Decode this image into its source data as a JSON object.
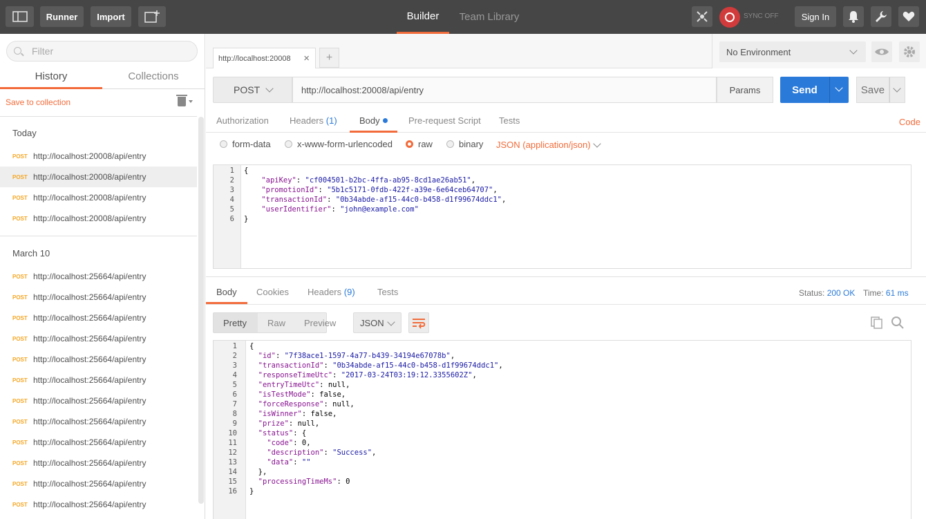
{
  "topbar": {
    "runner_label": "Runner",
    "import_label": "Import",
    "builder_label": "Builder",
    "team_library_label": "Team Library",
    "sync_label": "SYNC OFF",
    "sign_in_label": "Sign In"
  },
  "sidebar": {
    "filter_placeholder": "Filter",
    "tab_history": "History",
    "tab_collections": "Collections",
    "save_to_collection": "Save to collection",
    "groups": [
      {
        "title": "Today",
        "items": [
          {
            "method": "POST",
            "url": "http://localhost:20008/api/entry"
          },
          {
            "method": "POST",
            "url": "http://localhost:20008/api/entry"
          },
          {
            "method": "POST",
            "url": "http://localhost:20008/api/entry"
          },
          {
            "method": "POST",
            "url": "http://localhost:20008/api/entry"
          }
        ]
      },
      {
        "title": "March 10",
        "items": [
          {
            "method": "POST",
            "url": "http://localhost:25664/api/entry"
          },
          {
            "method": "POST",
            "url": "http://localhost:25664/api/entry"
          },
          {
            "method": "POST",
            "url": "http://localhost:25664/api/entry"
          },
          {
            "method": "POST",
            "url": "http://localhost:25664/api/entry"
          },
          {
            "method": "POST",
            "url": "http://localhost:25664/api/entry"
          },
          {
            "method": "POST",
            "url": "http://localhost:25664/api/entry"
          },
          {
            "method": "POST",
            "url": "http://localhost:25664/api/entry"
          },
          {
            "method": "POST",
            "url": "http://localhost:25664/api/entry"
          },
          {
            "method": "POST",
            "url": "http://localhost:25664/api/entry"
          },
          {
            "method": "POST",
            "url": "http://localhost:25664/api/entry"
          },
          {
            "method": "POST",
            "url": "http://localhost:25664/api/entry"
          },
          {
            "method": "POST",
            "url": "http://localhost:25664/api/entry"
          }
        ]
      }
    ]
  },
  "request": {
    "tab_label": "http://localhost:20008",
    "environment": "No Environment",
    "method": "POST",
    "url": "http://localhost:20008/api/entry",
    "params_label": "Params",
    "send_label": "Send",
    "save_label": "Save",
    "tabs": {
      "authorization": "Authorization",
      "headers": "Headers",
      "headers_count": "(1)",
      "body": "Body",
      "prerequest": "Pre-request Script",
      "tests": "Tests",
      "code": "Code"
    },
    "body_options": {
      "form_data": "form-data",
      "urlencoded": "x-www-form-urlencoded",
      "raw": "raw",
      "binary": "binary",
      "content_type": "JSON (application/json)"
    },
    "body_lines": [
      "{",
      "    \"apiKey\": \"cf004501-b2bc-4ffa-ab95-8cd1ae26ab51\",",
      "    \"promotionId\": \"5b1c5171-0fdb-422f-a39e-6e64ceb64707\",",
      "    \"transactionId\": \"0b34abde-af15-44c0-b458-d1f99674ddc1\",",
      "    \"userIdentifier\": \"john@example.com\"",
      "}"
    ]
  },
  "response": {
    "tabs": {
      "body": "Body",
      "cookies": "Cookies",
      "headers": "Headers",
      "headers_count": "(9)",
      "tests": "Tests"
    },
    "status_label": "Status:",
    "status_value": "200 OK",
    "time_label": "Time:",
    "time_value": "61 ms",
    "views": {
      "pretty": "Pretty",
      "raw": "Raw",
      "preview": "Preview"
    },
    "format": "JSON",
    "body_lines": [
      "{",
      "  \"id\": \"7f38ace1-1597-4a77-b439-34194e67078b\",",
      "  \"transactionId\": \"0b34abde-af15-44c0-b458-d1f99674ddc1\",",
      "  \"responseTimeUtc\": \"2017-03-24T03:19:12.3355602Z\",",
      "  \"entryTimeUtc\": null,",
      "  \"isTestMode\": false,",
      "  \"forceResponse\": null,",
      "  \"isWinner\": false,",
      "  \"prize\": null,",
      "  \"status\": {",
      "    \"code\": 0,",
      "    \"description\": \"Success\",",
      "    \"data\": \"\"",
      "  },",
      "  \"processingTimeMs\": 0",
      "}"
    ]
  },
  "colors": {
    "accent": "#f26b3a",
    "send": "#2a7ad9",
    "method_post": "#f5a623",
    "topbar": "#464646"
  }
}
